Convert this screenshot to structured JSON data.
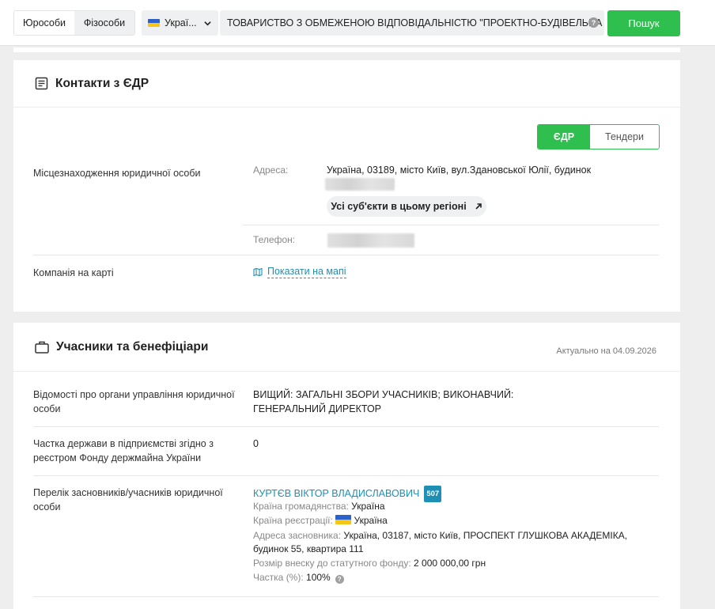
{
  "search": {
    "type_tabs": [
      "Юрособи",
      "Фізособи"
    ],
    "country": "Украї...",
    "query": "ТОВАРИСТВО З ОБМЕЖЕНОЮ ВІДПОВІДАЛЬНІСТЮ \"ПРОЕКТНО-БУДІВЕЛЬНА КОМПАНІЯ",
    "help": "?",
    "button": "Пошук"
  },
  "contacts": {
    "title": "Контакти з ЄДР",
    "source_tabs": [
      "ЄДР",
      "Тендери"
    ],
    "location_label": "Місцезнаходження юридичної особи",
    "address_label": "Адреса:",
    "address_value": "Україна, 03189, місто Київ, вул.Здановської Юлії, будинок",
    "region_button": "Усі суб'єкти в цьому регіоні",
    "phone_label": "Телефон:",
    "map_label": "Компанія на карті",
    "map_link": "Показати на мапі"
  },
  "participants": {
    "title": "Учасники та бенефіціари",
    "actual": "Актуально на 04.09.2026",
    "rows": [
      {
        "label": "Відомості про органи управління юридичної особи",
        "value": "ВИЩИЙ: ЗАГАЛЬНІ ЗБОРИ УЧАСНИКІВ; ВИКОНАВЧИЙ: ГЕНЕРАЛЬНИЙ ДИРЕКТОР"
      },
      {
        "label": "Частка держави в підприємстві згідно з реєстром Фонду держмайна України",
        "value": "0"
      }
    ],
    "founders_label": "Перелік засновників/учасників юридичної особи",
    "founder": {
      "name": "КУРТЄВ ВІКТОР ВЛАДИСЛАВОВИЧ",
      "badge": "507",
      "citizenship_key": "Країна громадянства:",
      "citizenship_value": "Україна",
      "registration_key": "Країна реєстрації:",
      "registration_value": "Україна",
      "address_key": "Адреса засновника:",
      "address_value": "Україна, 03187, місто Київ, ПРОСПЕКТ ГЛУШКОВА АКАДЕМІКА, будинок 55, квартира 111",
      "capital_key": "Розмір внеску до статутного фонду:",
      "capital_value": "2 000 000,00 грн",
      "share_key": "Частка (%):",
      "share_value": "100%"
    }
  }
}
